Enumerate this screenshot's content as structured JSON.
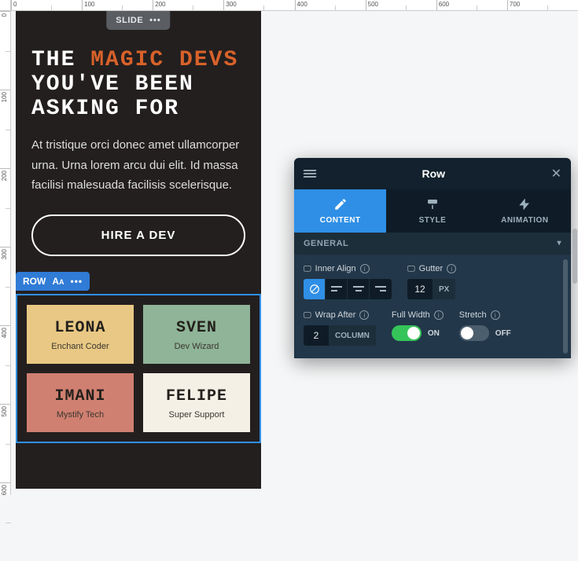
{
  "ruler_h": [
    "0",
    "100",
    "200",
    "300",
    "400",
    "500",
    "600",
    "700"
  ],
  "ruler_v": [
    "0",
    "100",
    "200",
    "300",
    "400",
    "500",
    "600"
  ],
  "slide": {
    "badge": "SLIDE",
    "headline_pre": "THE ",
    "headline_accent": "MAGIC DEVS",
    "headline_post": " YOU'VE BEEN ASKING FOR",
    "body": "At tristique orci donec amet ullamcorper urna. Urna lorem arcu dui elit. Id massa facilisi malesuada facilisis scelerisque.",
    "cta": "HIRE A DEV"
  },
  "row": {
    "toolbar_label": "ROW",
    "cards": [
      {
        "name": "LEONA",
        "role": "Enchant Coder"
      },
      {
        "name": "SVEN",
        "role": "Dev Wizard"
      },
      {
        "name": "IMANI",
        "role": "Mystify Tech"
      },
      {
        "name": "FELIPE",
        "role": "Super Support"
      }
    ]
  },
  "panel": {
    "title": "Row",
    "tabs": {
      "content": "CONTENT",
      "style": "STYLE",
      "animation": "ANIMATION"
    },
    "section": "GENERAL",
    "inner_align": {
      "label": "Inner Align"
    },
    "gutter": {
      "label": "Gutter",
      "value": "12",
      "unit": "PX"
    },
    "wrap_after": {
      "label": "Wrap After",
      "value": "2",
      "unit": "COLUMN"
    },
    "full_width": {
      "label": "Full Width",
      "state": "ON"
    },
    "stretch": {
      "label": "Stretch",
      "state": "OFF"
    }
  }
}
